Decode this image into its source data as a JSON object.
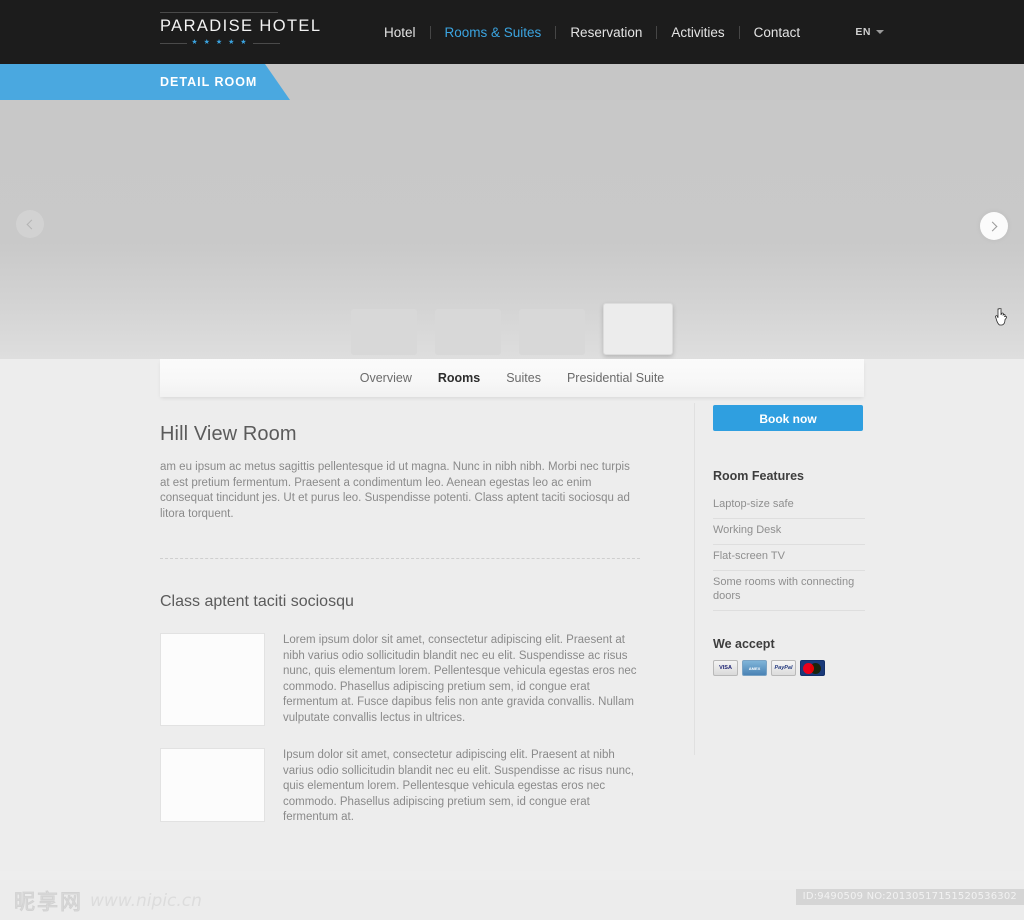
{
  "header": {
    "logo": {
      "name": "PARADISE HOTEL",
      "stars": "★ ★ ★ ★ ★"
    },
    "nav": [
      {
        "label": "Hotel",
        "active": false
      },
      {
        "label": "Rooms & Suites",
        "active": true
      },
      {
        "label": "Reservation",
        "active": false
      },
      {
        "label": "Activities",
        "active": false
      },
      {
        "label": "Contact",
        "active": false
      }
    ],
    "language": {
      "label": "EN"
    },
    "accent_color": "#3ba4e0",
    "bar_color": "#1c1c1c"
  },
  "banner": {
    "title": "DETAIL ROOM",
    "color": "#4aa8e0"
  },
  "hero": {
    "prev_label": "‹",
    "next_label": "›",
    "thumbnails": [
      {
        "index": 1,
        "active": false
      },
      {
        "index": 2,
        "active": false
      },
      {
        "index": 3,
        "active": false
      },
      {
        "index": 4,
        "active": true
      }
    ]
  },
  "tabs": [
    {
      "label": "Overview",
      "active": false
    },
    {
      "label": "Rooms",
      "active": true
    },
    {
      "label": "Suites",
      "active": false
    },
    {
      "label": "Presidential Suite",
      "active": false
    }
  ],
  "main": {
    "room_title": "Hill View Room",
    "intro": "am eu ipsum ac metus sagittis pellentesque id ut magna. Nunc in nibh nibh. Morbi nec turpis at est pretium fermentum. Praesent a condimentum leo. Aenean egestas leo ac enim consequat tincidunt jes. Ut et purus leo. Suspendisse potenti. Class aptent taciti sociosqu ad litora torquent.",
    "section_title": "Class aptent taciti sociosqu",
    "blocks": [
      {
        "text": "Lorem ipsum dolor sit amet, consectetur adipiscing elit. Praesent at nibh varius odio sollicitudin blandit nec eu elit. Suspendisse ac risus nunc, quis elementum lorem. Pellentesque vehicula egestas eros nec commodo. Phasellus adipiscing pretium sem, id congue erat fermentum at. Fusce dapibus felis non ante gravida convallis. Nullam vulputate convallis lectus in ultrices."
      },
      {
        "text": "Ipsum dolor sit amet, consectetur adipiscing elit. Praesent at nibh varius odio sollicitudin blandit nec eu elit. Suspendisse ac risus nunc, quis elementum lorem. Pellentesque vehicula egestas eros nec commodo. Phasellus adipiscing pretium sem, id congue erat fermentum at."
      }
    ]
  },
  "sidebar": {
    "book_label": "Book now",
    "book_color": "#2f9fe0",
    "features_title": "Room Features",
    "features": [
      "Laptop-size safe",
      "Working Desk",
      "Flat-screen TV",
      "Some rooms with connecting doors"
    ],
    "accept_title": "We accept",
    "payments": [
      {
        "name": "visa-icon",
        "label": "VISA"
      },
      {
        "name": "amex-icon",
        "label": "AMERICAN EXPRESS"
      },
      {
        "name": "paypal-icon",
        "label": "PayPal"
      },
      {
        "name": "mastercard-icon",
        "label": ""
      }
    ]
  },
  "footer": {
    "watermark_cn": "昵享网",
    "watermark_url": "www.nipic.cn",
    "id_text": "ID:9490509 NO:20130517151520536302"
  }
}
